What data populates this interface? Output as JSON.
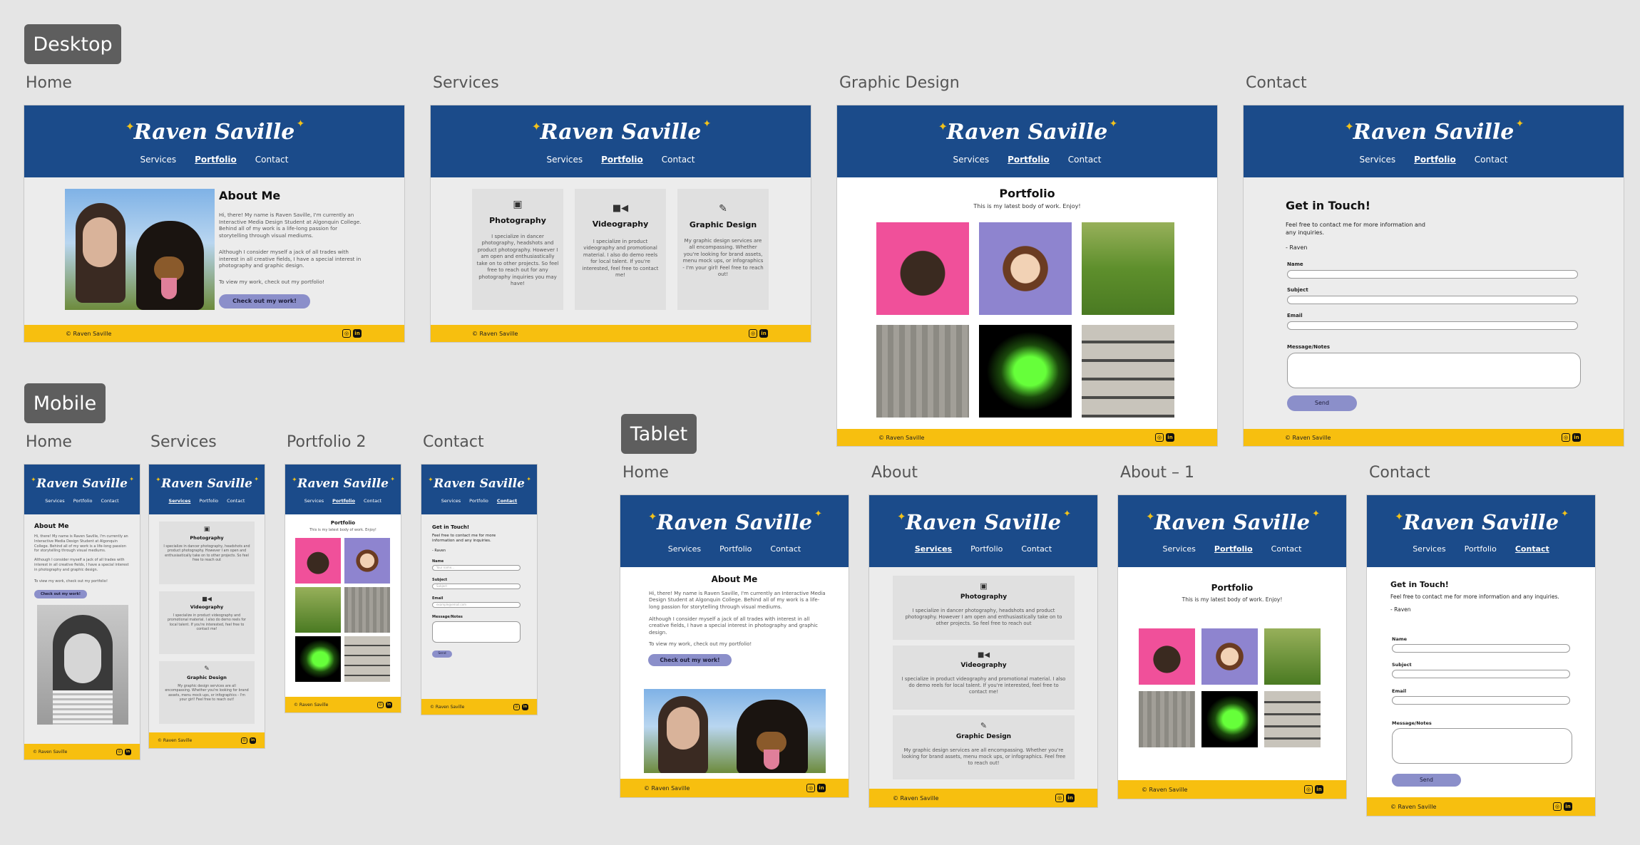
{
  "groups": {
    "desktop": "Desktop",
    "mobile": "Mobile",
    "tablet": "Tablet"
  },
  "frames": {
    "d_home": "Home",
    "d_services": "Services",
    "d_graphic": "Graphic Design",
    "d_contact": "Contact",
    "m_home": "Home",
    "m_services": "Services",
    "m_portfolio": "Portfolio 2",
    "m_contact": "Contact",
    "t_home": "Home",
    "t_about": "About",
    "t_about1": "About – 1",
    "t_contact": "Contact"
  },
  "site": {
    "logo": "Raven Saville",
    "nav": {
      "services": "Services",
      "portfolio": "Portfolio",
      "contact": "Contact"
    },
    "footer": "© Raven Saville",
    "icons": {
      "instagram": "instagram-icon",
      "linkedin": "linkedin-icon"
    },
    "colors": {
      "header": "#1b4b8a",
      "footer": "#f7bf0f",
      "button": "#8b8fca",
      "star": "#f2c21b"
    }
  },
  "about": {
    "title": "About Me",
    "p1": "Hi, there! My name is Raven Saville, I'm currently an Interactive Media Design Student at Algonquin College. Behind all of my work is a life-long passion for storytelling through visual mediums.",
    "p2": "Although I consider myself a jack of all trades with interest in all creative fields, I have a special interest in photography and graphic design.",
    "p3": "To view my work, check out my portfolio!",
    "cta": "Check out my work!"
  },
  "services": {
    "photo_title": "Photography",
    "photo_text": "I specialize in dancer photography, headshots and product photography. However I am open and enthusiastically take on to other projects. So feel free to reach out for any photography inquiries you may have!",
    "photo_text_short": "I specialize in dancer photography, headshots and product photography. However I am open and enthusiastically take on to other projects. So feel free to reach out",
    "video_title": "Videography",
    "video_text": "I specialize in product videography and promotional material. I also do demo reels for local talent. If you're interested, feel free to contact me!",
    "design_title": "Graphic Design",
    "design_text": "My graphic design services are all encompassing. Whether you're looking for brand assets, menu mock ups, or infographics - I'm your girl! Feel free to reach out!",
    "design_text_tablet": "My graphic design services are all encompassing. Whether you're looking for brand assets, menu mock ups, or infographics. Feel free to reach out!"
  },
  "portfolio": {
    "title": "Portfolio",
    "subtitle": "This is my latest body of work. Enjoy!"
  },
  "contact": {
    "title": "Get  in Touch!",
    "text": "Feel free to contact me for more information and any inquiries.",
    "sign": "- Raven",
    "name": "Name",
    "subject": "Subject",
    "email": "Email",
    "message": "Message/Notes",
    "send": "Send",
    "name_ph": "Your name...",
    "subject_ph": "Subject",
    "email_ph": "example@email.com"
  }
}
